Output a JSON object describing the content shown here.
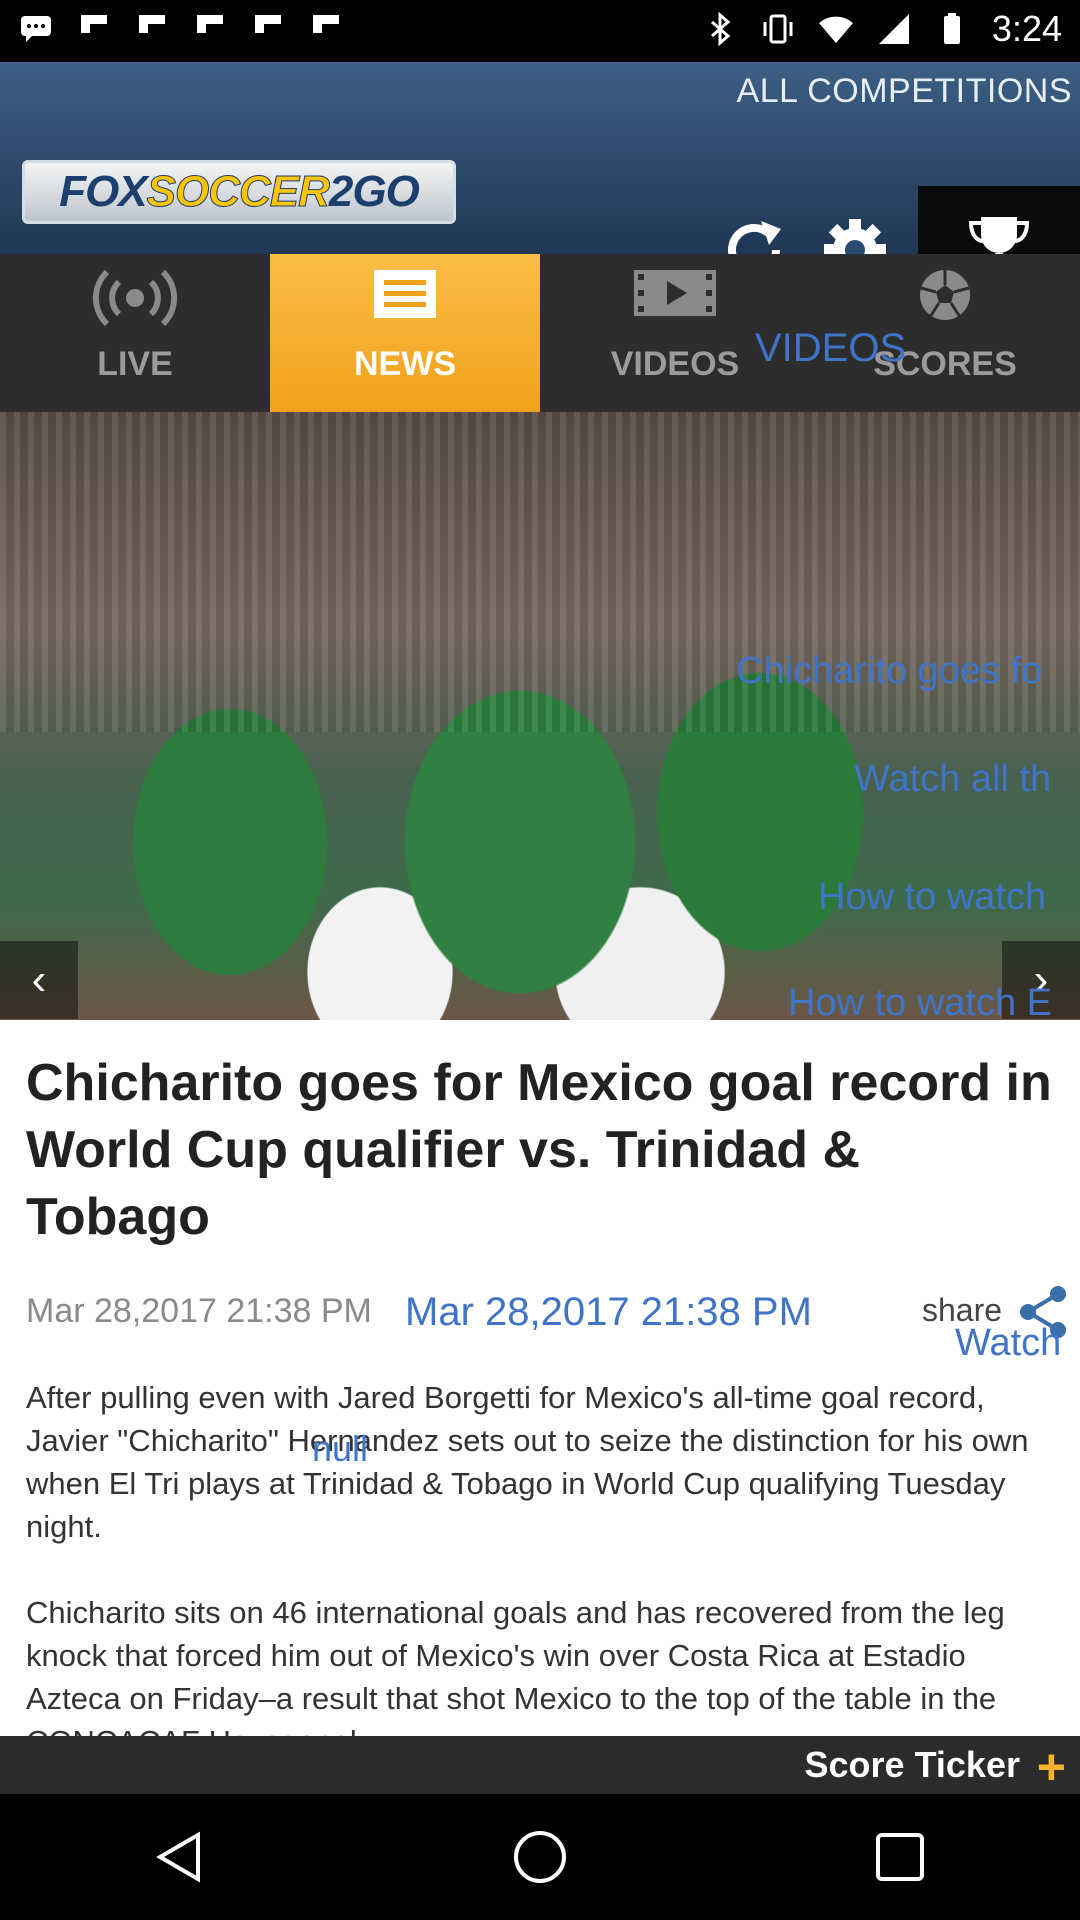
{
  "status_bar": {
    "time": "3:24",
    "left_icons": [
      "messages-icon",
      "flipboard-icon",
      "flipboard-icon",
      "flipboard-icon",
      "flipboard-icon",
      "flipboard-icon"
    ],
    "right_icons": [
      "bluetooth-icon",
      "vibrate-icon",
      "wifi-icon",
      "cellular-signal-icon",
      "battery-icon"
    ]
  },
  "header": {
    "all_competitions": "ALL COMPETITIONS",
    "logo_text_1": "FOX",
    "logo_text_2": "SOCCER",
    "logo_text_3": "2GO"
  },
  "tabs": [
    {
      "label": "LIVE",
      "icon": "broadcast-icon",
      "active": false
    },
    {
      "label": "NEWS",
      "icon": "news-icon",
      "active": true
    },
    {
      "label": "VIDEOS",
      "icon": "film-icon",
      "active": false
    },
    {
      "label": "SCORES",
      "icon": "soccer-ball-icon",
      "active": false
    }
  ],
  "overlay_videos": "VIDEOS",
  "hero": {
    "overlays": [
      "Chicharito goes fo",
      "Watch all th",
      "How to watch",
      "How to watch E"
    ]
  },
  "article": {
    "title": "Chicharito goes for Mexico goal record in World Cup qualifier vs. Trinidad & Tobago",
    "date": "Mar 28,2017 21:38 PM",
    "date_overlay": "Mar 28,2017 21:38 PM",
    "share_label": "share",
    "watch_overlay": "Watch",
    "null_overlay": "null",
    "paragraphs": [
      "After pulling even with Jared Borgetti for Mexico's all-time goal record, Javier \"Chicharito\" Hernandez sets out to seize the distinction for his own when El Tri plays at Trinidad & Tobago in World Cup qualifying Tuesday night.",
      "Chicharito sits on 46 international goals and has recovered from the leg knock that forced him out of Mexico's win over Costa Rica at Estadio Azteca on Friday–a result that shot Mexico to the top of the table in the CONCACAF Hexagonal."
    ]
  },
  "ticker": {
    "label": "Score Ticker",
    "plus": "+"
  },
  "colors": {
    "accent_orange": "#f1a21c",
    "header_blue": "#2b4a6f",
    "overlay_blue": "#3f74c8",
    "tab_bar": "#2d2d2d"
  }
}
